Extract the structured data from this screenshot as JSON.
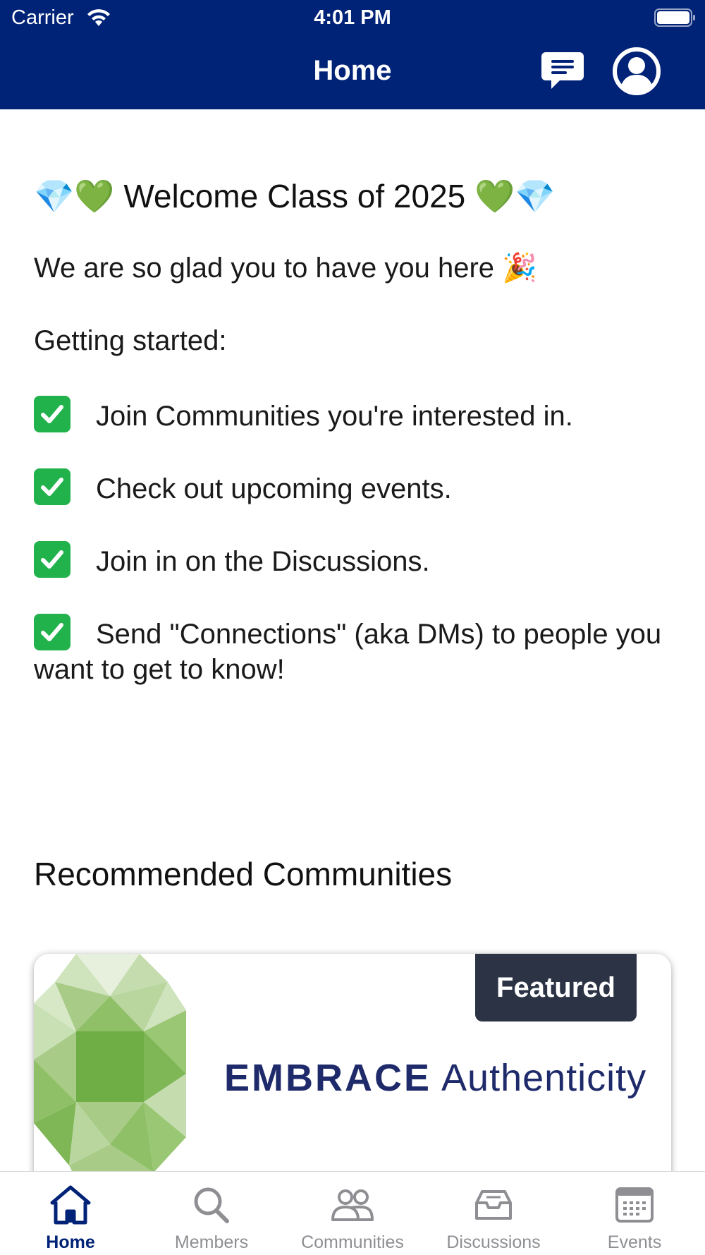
{
  "status_bar": {
    "carrier": "Carrier",
    "time": "4:01 PM"
  },
  "nav": {
    "title": "Home"
  },
  "welcome": {
    "title": "💎💚 Welcome Class of 2025 💚💎",
    "intro": "We are so glad you to have you here 🎉",
    "getting_started": "Getting started:",
    "items": [
      "Join Communities you're interested in.",
      "Check out upcoming events.",
      "Join in on the Discussions.",
      "Send \"Connections\" (aka DMs) to people you want to get to know!"
    ]
  },
  "recommended": {
    "title": "Recommended Communities",
    "card": {
      "badge": "Featured",
      "brand_bold": "EMBRACE",
      "brand_light": "Authenticity"
    }
  },
  "tabs": [
    {
      "label": "Home",
      "icon": "home-icon",
      "active": true
    },
    {
      "label": "Members",
      "icon": "search-icon",
      "active": false
    },
    {
      "label": "Communities",
      "icon": "people-icon",
      "active": false
    },
    {
      "label": "Discussions",
      "icon": "inbox-icon",
      "active": false
    },
    {
      "label": "Events",
      "icon": "calendar-icon",
      "active": false
    }
  ],
  "colors": {
    "header": "#002277",
    "check": "#22b24c",
    "badge": "#2b3345",
    "brand": "#1f2a6b",
    "tab_active": "#002277",
    "tab_inactive": "#8e8e93"
  }
}
